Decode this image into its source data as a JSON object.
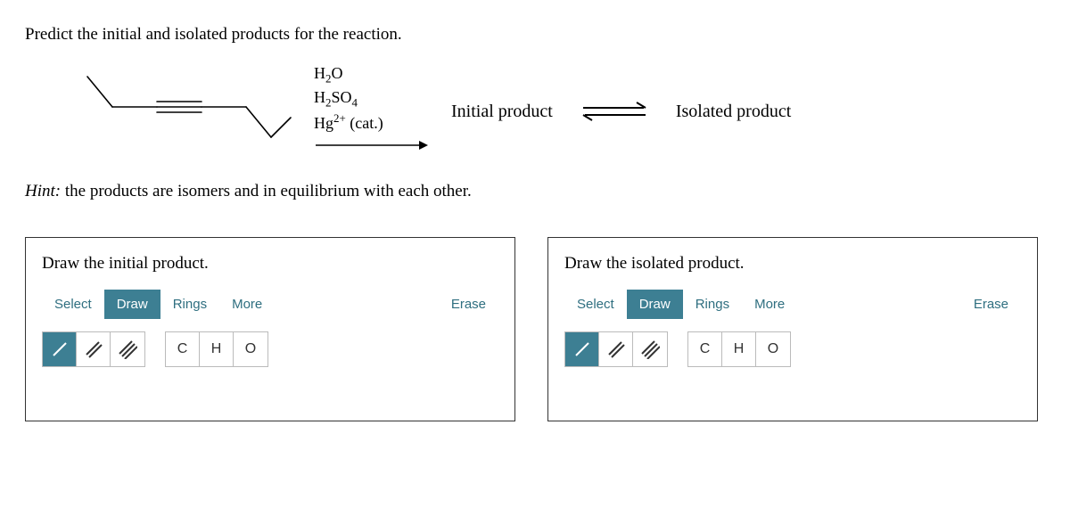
{
  "question": "Predict the initial and isolated products for the reaction.",
  "reagents": {
    "line1_a": "H",
    "line1_b": "O",
    "line2_a": "H",
    "line2_b": "SO",
    "line3_a": "Hg",
    "line3_b": " (cat.)"
  },
  "labels": {
    "initial": "Initial product",
    "isolated": "Isolated product"
  },
  "hint_prefix": "Hint:",
  "hint_body": " the products are isomers and in equilibrium with each other.",
  "editor1": {
    "title": "Draw the initial product."
  },
  "editor2": {
    "title": "Draw the isolated product."
  },
  "tabs": {
    "select": "Select",
    "draw": "Draw",
    "rings": "Rings",
    "more": "More",
    "erase": "Erase"
  },
  "atoms": {
    "c": "C",
    "h": "H",
    "o": "O"
  }
}
